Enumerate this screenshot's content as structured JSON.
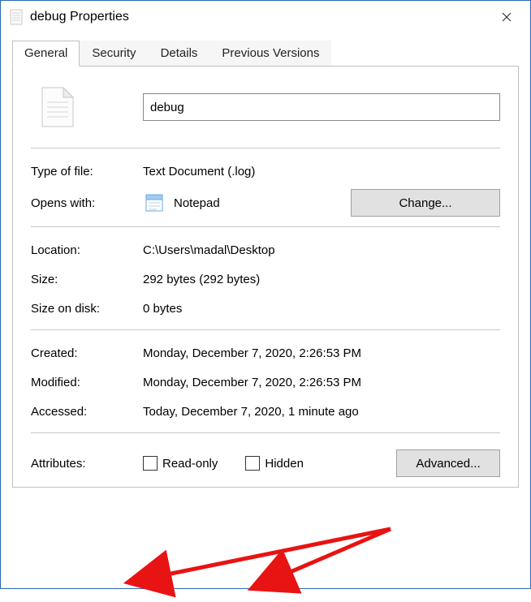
{
  "window": {
    "title": "debug Properties"
  },
  "tabs": {
    "general": "General",
    "security": "Security",
    "details": "Details",
    "previous_versions": "Previous Versions"
  },
  "file": {
    "name": "debug"
  },
  "labels": {
    "type_of_file": "Type of file:",
    "opens_with": "Opens with:",
    "location": "Location:",
    "size": "Size:",
    "size_on_disk": "Size on disk:",
    "created": "Created:",
    "modified": "Modified:",
    "accessed": "Accessed:",
    "attributes": "Attributes:"
  },
  "values": {
    "type_of_file": "Text Document (.log)",
    "opens_with_app": "Notepad",
    "location": "C:\\Users\\madal\\Desktop",
    "size": "292 bytes (292 bytes)",
    "size_on_disk": "0 bytes",
    "created": "Monday, December 7, 2020, 2:26:53 PM",
    "modified": "Monday, December 7, 2020, 2:26:53 PM",
    "accessed": "Today, December 7, 2020, 1 minute ago"
  },
  "buttons": {
    "change": "Change...",
    "advanced": "Advanced..."
  },
  "attributes": {
    "read_only": "Read-only",
    "hidden": "Hidden"
  }
}
